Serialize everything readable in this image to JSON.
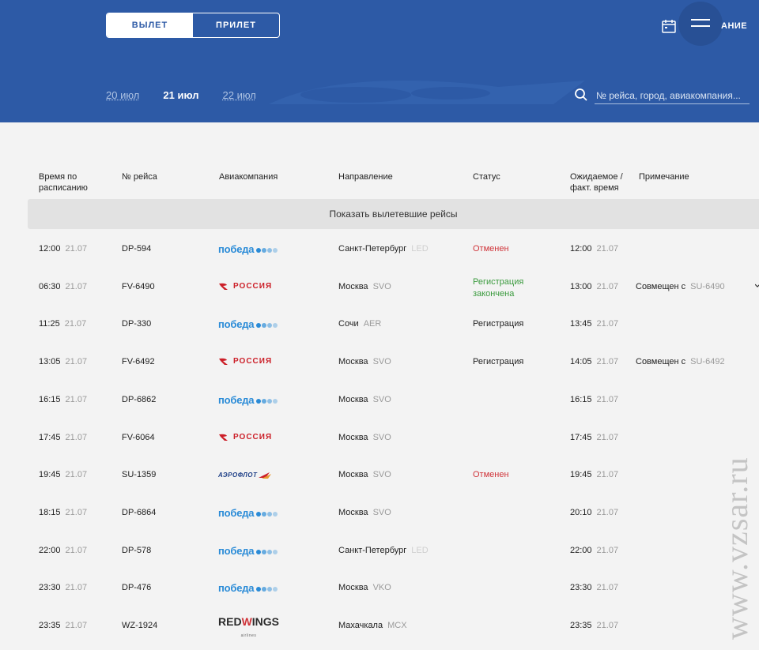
{
  "toggle": {
    "departure": "ВЫЛЕТ",
    "arrival": "ПРИЛЕТ"
  },
  "header": {
    "tail_text": "АНИЕ"
  },
  "dates": [
    "20 июл",
    "21 июл",
    "22 июл"
  ],
  "search": {
    "placeholder": "№ рейса, город, авиакомпания..."
  },
  "columns": {
    "scheduled": "Время по расписанию",
    "flight": "№ рейса",
    "airline": "Авиакомпания",
    "direction": "Направление",
    "status": "Статус",
    "expected": "Ожидаемое / факт. время",
    "note": "Примечание"
  },
  "show_departed": "Показать вылетевшие рейсы",
  "airline_logos": {
    "pobeda": "победа",
    "rossiya": "РОССИЯ",
    "aeroflot": "АЭРОФЛОТ",
    "redwings_a": "RED",
    "redwings_b": "W",
    "redwings_c": "INGS",
    "redwings_sub": "airlines"
  },
  "flights": [
    {
      "time": "12:00",
      "date": "21.07",
      "flight": "DP-594",
      "airline": "pobeda",
      "city": "Санкт-Петербург",
      "code": "LED",
      "status": "Отменен",
      "status_type": "cancel",
      "exp_time": "12:00",
      "exp_date": "21.07",
      "note": ""
    },
    {
      "time": "06:30",
      "date": "21.07",
      "flight": "FV-6490",
      "airline": "rossiya",
      "city": "Москва",
      "code": "SVO",
      "status": "Регистрация закончена",
      "status_type": "green",
      "exp_time": "13:00",
      "exp_date": "21.07",
      "note": "Совмещен с",
      "note_code": "SU-6490"
    },
    {
      "time": "11:25",
      "date": "21.07",
      "flight": "DP-330",
      "airline": "pobeda",
      "city": "Сочи",
      "code": "AER",
      "status": "Регистрация",
      "status_type": "normal",
      "exp_time": "13:45",
      "exp_date": "21.07",
      "note": ""
    },
    {
      "time": "13:05",
      "date": "21.07",
      "flight": "FV-6492",
      "airline": "rossiya",
      "city": "Москва",
      "code": "SVO",
      "status": "Регистрация",
      "status_type": "normal",
      "exp_time": "14:05",
      "exp_date": "21.07",
      "note": "Совмещен с",
      "note_code": "SU-6492"
    },
    {
      "time": "16:15",
      "date": "21.07",
      "flight": "DP-6862",
      "airline": "pobeda",
      "city": "Москва",
      "code": "SVO",
      "status": "",
      "status_type": "normal",
      "exp_time": "16:15",
      "exp_date": "21.07",
      "note": ""
    },
    {
      "time": "17:45",
      "date": "21.07",
      "flight": "FV-6064",
      "airline": "rossiya",
      "city": "Москва",
      "code": "SVO",
      "status": "",
      "status_type": "normal",
      "exp_time": "17:45",
      "exp_date": "21.07",
      "note": ""
    },
    {
      "time": "19:45",
      "date": "21.07",
      "flight": "SU-1359",
      "airline": "aeroflot",
      "city": "Москва",
      "code": "SVO",
      "status": "Отменен",
      "status_type": "cancel",
      "exp_time": "19:45",
      "exp_date": "21.07",
      "note": ""
    },
    {
      "time": "18:15",
      "date": "21.07",
      "flight": "DP-6864",
      "airline": "pobeda",
      "city": "Москва",
      "code": "SVO",
      "status": "",
      "status_type": "normal",
      "exp_time": "20:10",
      "exp_date": "21.07",
      "note": ""
    },
    {
      "time": "22:00",
      "date": "21.07",
      "flight": "DP-578",
      "airline": "pobeda",
      "city": "Санкт-Петербург",
      "code": "LED",
      "status": "",
      "status_type": "normal",
      "exp_time": "22:00",
      "exp_date": "21.07",
      "note": ""
    },
    {
      "time": "23:30",
      "date": "21.07",
      "flight": "DP-476",
      "airline": "pobeda",
      "city": "Москва",
      "code": "VKO",
      "status": "",
      "status_type": "normal",
      "exp_time": "23:30",
      "exp_date": "21.07",
      "note": ""
    },
    {
      "time": "23:35",
      "date": "21.07",
      "flight": "WZ-1924",
      "airline": "redwings",
      "city": "Махачкала",
      "code": "MCX",
      "status": "",
      "status_type": "normal",
      "exp_time": "23:35",
      "exp_date": "21.07",
      "note": ""
    }
  ],
  "watermark": "www.vzsar.ru",
  "colors": {
    "header_bg": "#2d5aa6",
    "cancel": "#d0343a",
    "ok": "#3a9a3d",
    "pobeda": "#2a8bd7",
    "rossiya": "#cc1f28"
  }
}
